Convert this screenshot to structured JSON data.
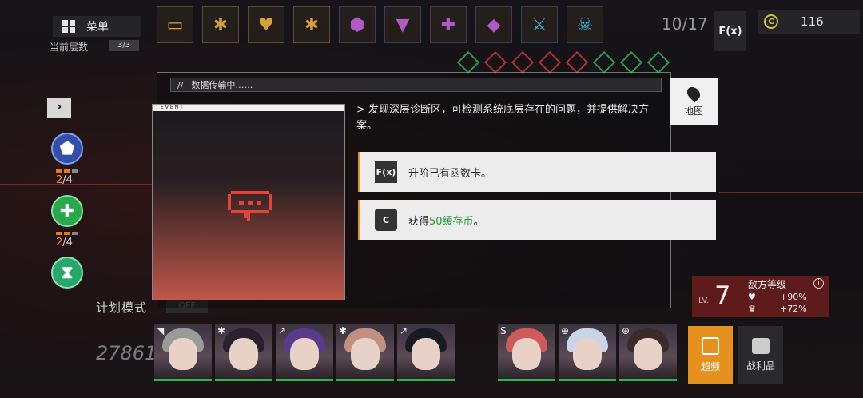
{
  "menu": {
    "label": "菜单"
  },
  "floor": {
    "label": "当前层数",
    "count": "3/3"
  },
  "buffs": {
    "count": "10/17"
  },
  "fx_button": {
    "label": "F(x)"
  },
  "currency": {
    "value": "116"
  },
  "skills": [
    {
      "name": "shield",
      "count_used": "2",
      "count_total": "/4"
    },
    {
      "name": "heal",
      "count_used": "2",
      "count_total": "/4"
    },
    {
      "name": "cycle"
    }
  ],
  "plan_mode": {
    "label": "计划模式",
    "toggle": "OFF"
  },
  "power": "27861",
  "event": {
    "header": "数据传输中……",
    "tab": "EVENT",
    "description": "> 发现深层诊断区，可检测系统底层存在的问题，并提供解决方案。",
    "options": [
      {
        "icon": "F(x)",
        "text": "升阶已有函数卡。"
      },
      {
        "icon": "C",
        "prefix": "获得",
        "highlight": "50缓存币",
        "suffix": "。"
      }
    ]
  },
  "map_button": {
    "label": "地图"
  },
  "enemy": {
    "title": "敌方等级",
    "lv_tag": "LV.",
    "lv_value": "7",
    "stat1_value": "+90%",
    "stat2_value": "+72%"
  },
  "actions": {
    "overclock": "超频",
    "loot": "战利品"
  },
  "colors": {
    "accent": "#e8902a",
    "highlight": "#2a9a3a"
  }
}
